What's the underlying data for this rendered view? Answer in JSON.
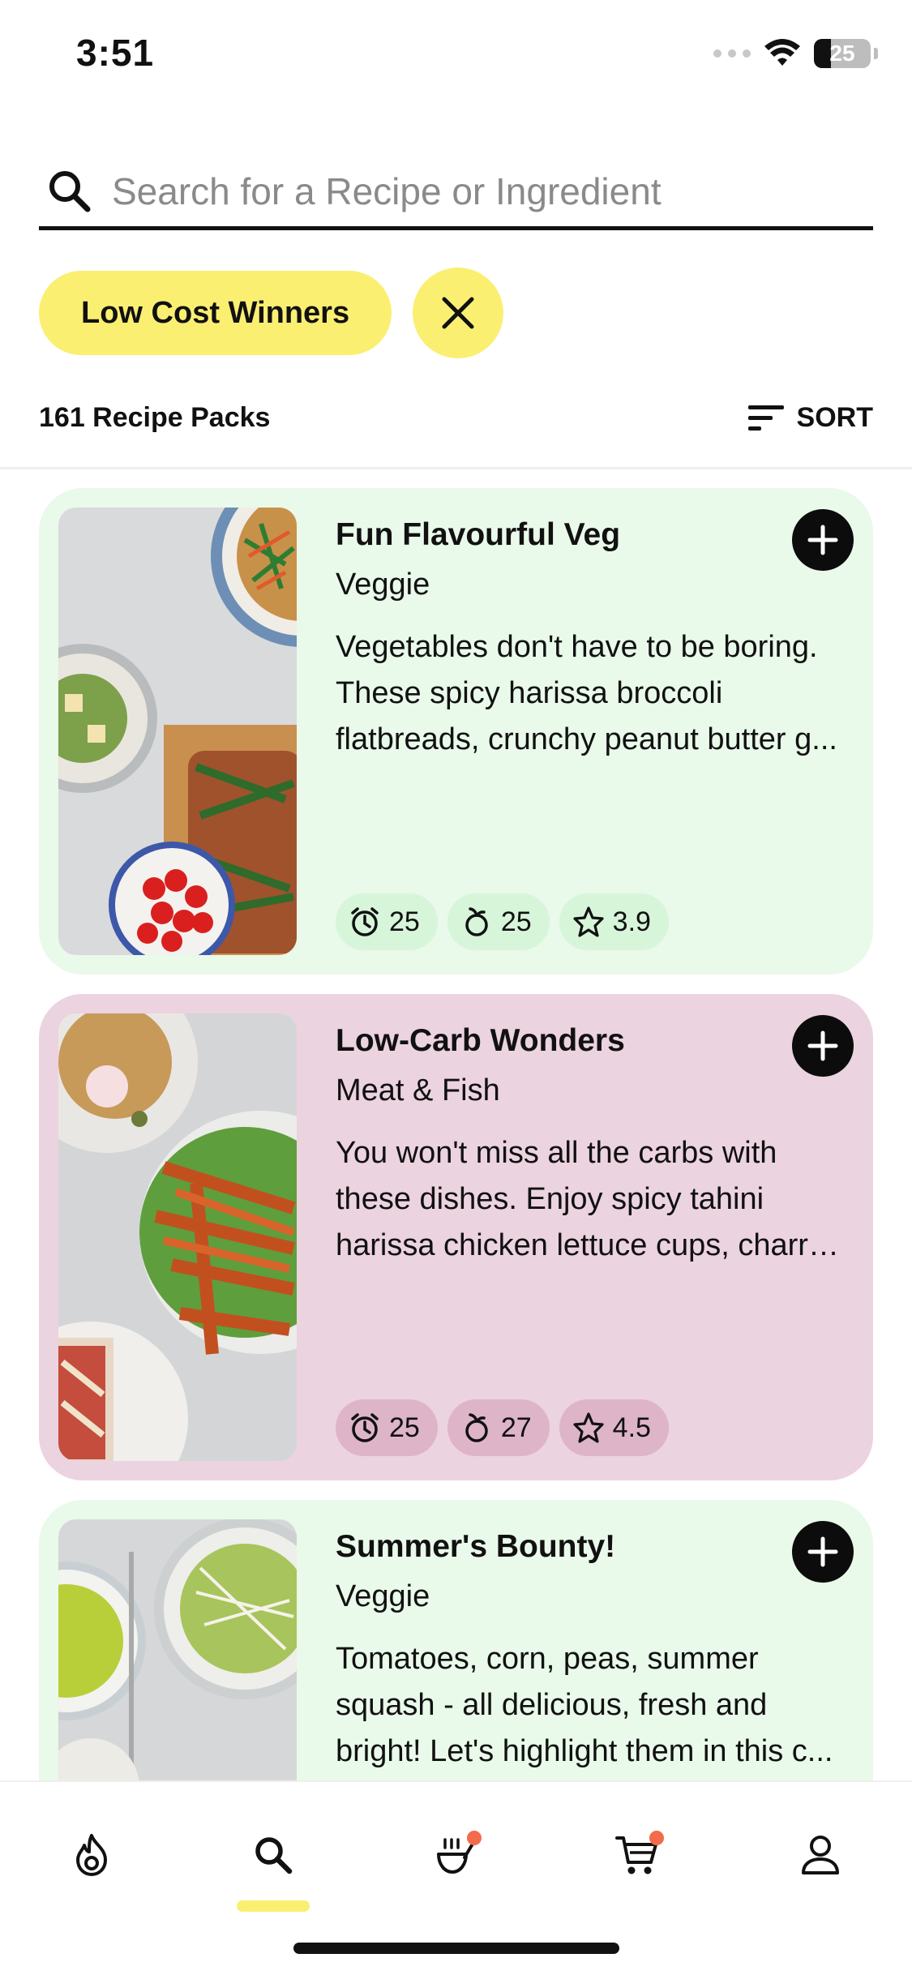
{
  "status_bar": {
    "time": "3:51",
    "battery": "25"
  },
  "search": {
    "placeholder": "Search for a Recipe or Ingredient"
  },
  "filters": {
    "active_chip": "Low Cost Winners"
  },
  "results": {
    "count_label": "161 Recipe Packs",
    "sort_label": "SORT"
  },
  "cards": [
    {
      "title": "Fun Flavourful Veg",
      "category": "Veggie",
      "description_lines": [
        "Vegetables don't have to be boring.",
        "These spicy harissa broccoli",
        "flatbreads, crunchy peanut butter g..."
      ],
      "time": "25",
      "calories": "25",
      "rating": "3.9",
      "bg_color": "#e9f9ea",
      "pill_color": "#d6f5d9"
    },
    {
      "title": "Low-Carb Wonders",
      "category": "Meat & Fish",
      "description_lines": [
        "You won't miss all the carbs with",
        "these dishes. Enjoy spicy tahini",
        "harissa chicken lettuce cups, charre..."
      ],
      "time": "25",
      "calories": "27",
      "rating": "4.5",
      "bg_color": "#ecd3e0",
      "pill_color": "#deb4c9"
    },
    {
      "title": "Summer's Bounty!",
      "category": "Veggie",
      "description_lines": [
        "Tomatoes, corn, peas, summer",
        "squash - all delicious, fresh and",
        "bright! Let's highlight them in this c..."
      ],
      "time": "",
      "calories": "",
      "rating": "",
      "bg_color": "#e9f9ea",
      "pill_color": "#d6f5d9"
    }
  ],
  "nav": {
    "items": [
      "flame-icon",
      "search-icon",
      "cooking-pot-icon",
      "cart-icon",
      "profile-icon"
    ],
    "active_index": 1,
    "accent": "#fbef72",
    "notification_color": "#f26b4a"
  }
}
